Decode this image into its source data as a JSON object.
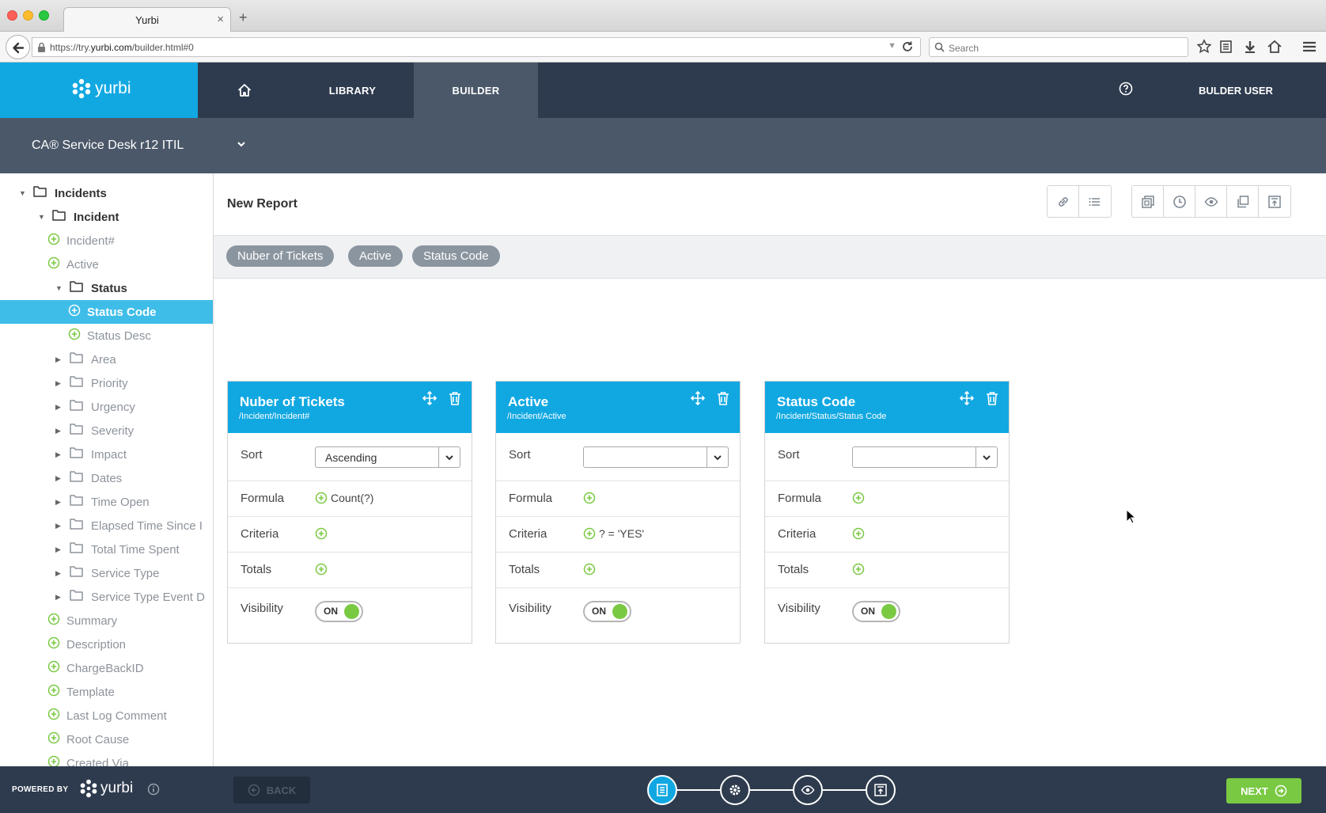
{
  "browser": {
    "tab_title": "Yurbi",
    "tab_close": "×",
    "new_tab": "+",
    "url_prefix": "https://try.",
    "url_domain": "yurbi.com",
    "url_path": "/builder.html#0",
    "search_placeholder": "Search"
  },
  "app": {
    "logo_text": "yurbi",
    "nav": {
      "library": "LIBRARY",
      "builder": "BUILDER"
    },
    "user": "BULDER USER",
    "project": "CA® Service Desk r12 ITIL",
    "brand_color": "#11a8e2",
    "header_color": "#2e3b4e",
    "accent_green": "#7ac943"
  },
  "sidebar": {
    "items": [
      {
        "label": "Incidents",
        "type": "folder",
        "expanded": true,
        "depth": 0
      },
      {
        "label": "Incident",
        "type": "folder",
        "expanded": true,
        "depth": 1
      },
      {
        "label": "Incident#",
        "type": "field",
        "depth": 2
      },
      {
        "label": "Active",
        "type": "field",
        "depth": 2
      },
      {
        "label": "Status",
        "type": "folder",
        "expanded": true,
        "depth": 2
      },
      {
        "label": "Status Code",
        "type": "field",
        "depth": 3,
        "selected": true
      },
      {
        "label": "Status Desc",
        "type": "field",
        "depth": 3
      },
      {
        "label": "Area",
        "type": "folder",
        "expanded": false,
        "depth": 2
      },
      {
        "label": "Priority",
        "type": "folder",
        "expanded": false,
        "depth": 2
      },
      {
        "label": "Urgency",
        "type": "folder",
        "expanded": false,
        "depth": 2
      },
      {
        "label": "Severity",
        "type": "folder",
        "expanded": false,
        "depth": 2
      },
      {
        "label": "Impact",
        "type": "folder",
        "expanded": false,
        "depth": 2
      },
      {
        "label": "Dates",
        "type": "folder",
        "expanded": false,
        "depth": 2
      },
      {
        "label": "Time Open",
        "type": "folder",
        "expanded": false,
        "depth": 2
      },
      {
        "label": "Elapsed Time Since I",
        "type": "folder",
        "expanded": false,
        "depth": 2
      },
      {
        "label": "Total Time Spent",
        "type": "folder",
        "expanded": false,
        "depth": 2
      },
      {
        "label": "Service Type",
        "type": "folder",
        "expanded": false,
        "depth": 2
      },
      {
        "label": "Service Type Event D",
        "type": "folder",
        "expanded": false,
        "depth": 2
      },
      {
        "label": "Summary",
        "type": "field",
        "depth": 2
      },
      {
        "label": "Description",
        "type": "field",
        "depth": 2
      },
      {
        "label": "ChargeBackID",
        "type": "field",
        "depth": 2
      },
      {
        "label": "Template",
        "type": "field",
        "depth": 2
      },
      {
        "label": "Last Log Comment",
        "type": "field",
        "depth": 2
      },
      {
        "label": "Root Cause",
        "type": "field",
        "depth": 2
      },
      {
        "label": "Created Via",
        "type": "field",
        "depth": 2
      }
    ]
  },
  "report": {
    "title": "New Report",
    "chips": [
      "Nuber of Tickets",
      "Active",
      "Status Code"
    ],
    "row_labels": {
      "sort": "Sort",
      "formula": "Formula",
      "criteria": "Criteria",
      "totals": "Totals",
      "visibility": "Visibility"
    },
    "cards": [
      {
        "title": "Nuber of Tickets",
        "path": "/Incident/Incident#",
        "sort": "Ascending",
        "formula": "Count(?)",
        "criteria": "",
        "totals": "",
        "visibility": "ON"
      },
      {
        "title": "Active",
        "path": "/Incident/Active",
        "sort": "",
        "formula": "",
        "criteria": "? = 'YES'",
        "totals": "",
        "visibility": "ON"
      },
      {
        "title": "Status Code",
        "path": "/Incident/Status/Status Code",
        "sort": "",
        "formula": "",
        "criteria": "",
        "totals": "",
        "visibility": "ON"
      }
    ]
  },
  "footer": {
    "powered_by": "POWERED BY",
    "logo_text": "yurbi",
    "back": "BACK",
    "next": "NEXT",
    "steps": [
      "design-icon",
      "settings-icon",
      "preview-icon",
      "publish-icon"
    ],
    "active_step": 0
  }
}
